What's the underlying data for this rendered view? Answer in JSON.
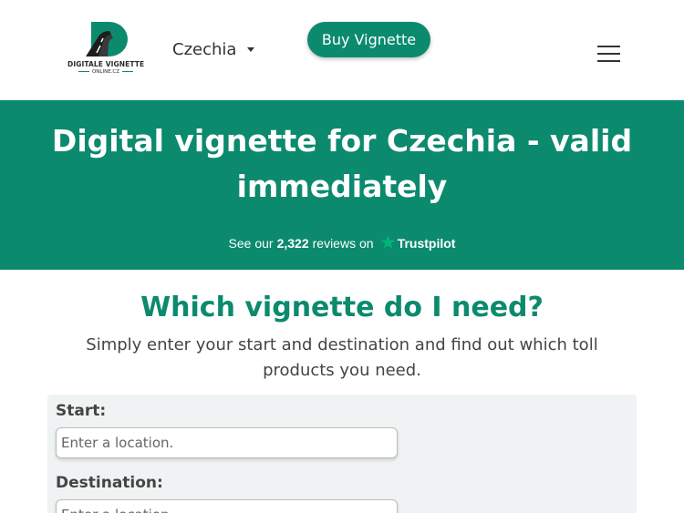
{
  "header": {
    "logo_line1": "DIGITALE VIGNETTE",
    "logo_line2": "ONLINE.CZ",
    "country": "Czechia",
    "buy_button": "Buy Vignette"
  },
  "hero": {
    "title": "Digital vignette for Czechia - valid immediately",
    "trust_prefix": "See our",
    "trust_count": "2,322",
    "trust_suffix": "reviews on",
    "trust_brand": "Trustpilot"
  },
  "main": {
    "question": "Which vignette do I need?",
    "subtitle": "Simply enter your start and destination and find out which toll products you need.",
    "start_label": "Start:",
    "start_placeholder": "Enter a location.",
    "destination_label": "Destination:",
    "destination_placeholder": "Enter a location."
  },
  "colors": {
    "brand": "#0b8a6e",
    "trustpilot_star": "#00b67a"
  },
  "icons": [
    "logo-road-icon",
    "caret-down-icon",
    "hamburger-menu-icon",
    "trustpilot-star-icon"
  ]
}
